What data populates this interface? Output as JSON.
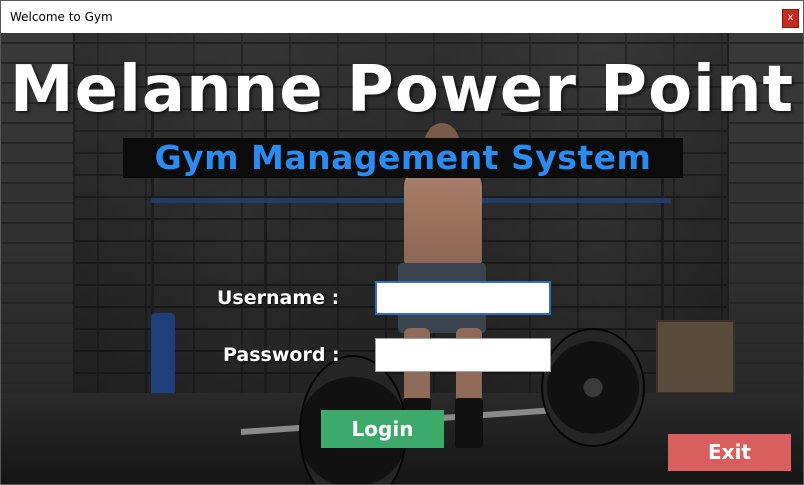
{
  "window": {
    "title": "Welcome to Gym",
    "close_label": "x"
  },
  "header": {
    "title": "Melanne Power Point",
    "subtitle": "Gym Management System"
  },
  "login_form": {
    "username_label": "Username :",
    "username_value": "",
    "password_label": "Password :",
    "password_value": "",
    "login_button": "Login",
    "exit_button": "Exit"
  },
  "colors": {
    "subtitle_text": "#2a8cf0",
    "login_button": "#3daa6b",
    "exit_button": "#d95e5e",
    "close_button": "#c42b1c"
  }
}
